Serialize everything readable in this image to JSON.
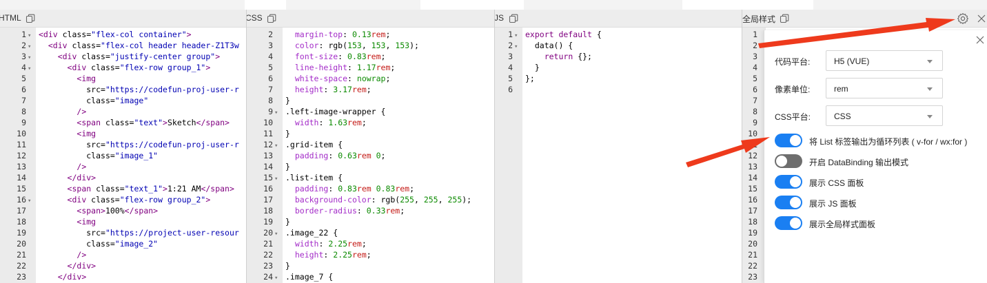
{
  "panels": {
    "html": {
      "title": "HTML"
    },
    "css": {
      "title": "CSS"
    },
    "js": {
      "title": "JS"
    },
    "global": {
      "title": "全局样式"
    }
  },
  "html_lines": [
    [
      [
        [
          "tag",
          "<div "
        ],
        [
          "attr",
          "class="
        ],
        [
          "str",
          "\"flex-col container\""
        ],
        [
          "tag",
          ">"
        ]
      ]
    ],
    [
      [
        [
          "txt",
          "  "
        ],
        [
          "tag",
          "<div "
        ],
        [
          "attr",
          "class="
        ],
        [
          "str",
          "\"flex-col header header-Z1T3w"
        ]
      ]
    ],
    [
      [
        [
          "txt",
          "    "
        ],
        [
          "tag",
          "<div "
        ],
        [
          "attr",
          "class="
        ],
        [
          "str",
          "\"justify-center group\""
        ],
        [
          "tag",
          ">"
        ]
      ]
    ],
    [
      [
        [
          "txt",
          "      "
        ],
        [
          "tag",
          "<div "
        ],
        [
          "attr",
          "class="
        ],
        [
          "str",
          "\"flex-row group_1\""
        ],
        [
          "tag",
          ">"
        ]
      ]
    ],
    [
      [
        [
          "txt",
          "        "
        ],
        [
          "tag",
          "<img"
        ]
      ]
    ],
    [
      [
        [
          "txt",
          "          "
        ],
        [
          "attr",
          "src="
        ],
        [
          "str",
          "\"https://codefun-proj-user-r"
        ]
      ]
    ],
    [
      [
        [
          "txt",
          "          "
        ],
        [
          "attr",
          "class="
        ],
        [
          "str",
          "\"image\""
        ]
      ]
    ],
    [
      [
        [
          "txt",
          "        "
        ],
        [
          "tag",
          "/>"
        ]
      ]
    ],
    [
      [
        [
          "txt",
          "        "
        ],
        [
          "tag",
          "<span "
        ],
        [
          "attr",
          "class="
        ],
        [
          "str",
          "\"text\""
        ],
        [
          "tag",
          ">"
        ],
        [
          "txt",
          "Sketch"
        ],
        [
          "tag",
          "</span>"
        ]
      ]
    ],
    [
      [
        [
          "txt",
          "        "
        ],
        [
          "tag",
          "<img"
        ]
      ]
    ],
    [
      [
        [
          "txt",
          "          "
        ],
        [
          "attr",
          "src="
        ],
        [
          "str",
          "\"https://codefun-proj-user-r"
        ]
      ]
    ],
    [
      [
        [
          "txt",
          "          "
        ],
        [
          "attr",
          "class="
        ],
        [
          "str",
          "\"image_1\""
        ]
      ]
    ],
    [
      [
        [
          "txt",
          "        "
        ],
        [
          "tag",
          "/>"
        ]
      ]
    ],
    [
      [
        [
          "txt",
          "      "
        ],
        [
          "tag",
          "</div>"
        ]
      ]
    ],
    [
      [
        [
          "txt",
          "      "
        ],
        [
          "tag",
          "<span "
        ],
        [
          "attr",
          "class="
        ],
        [
          "str",
          "\"text_1\""
        ],
        [
          "tag",
          ">"
        ],
        [
          "txt",
          "1:21 AM"
        ],
        [
          "tag",
          "</span>"
        ]
      ]
    ],
    [
      [
        [
          "txt",
          "      "
        ],
        [
          "tag",
          "<div "
        ],
        [
          "attr",
          "class="
        ],
        [
          "str",
          "\"flex-row group_2\""
        ],
        [
          "tag",
          ">"
        ]
      ]
    ],
    [
      [
        [
          "txt",
          "        "
        ],
        [
          "tag",
          "<span>"
        ],
        [
          "txt",
          "100%"
        ],
        [
          "tag",
          "</span>"
        ]
      ]
    ],
    [
      [
        [
          "txt",
          "        "
        ],
        [
          "tag",
          "<img"
        ]
      ]
    ],
    [
      [
        [
          "txt",
          "          "
        ],
        [
          "attr",
          "src="
        ],
        [
          "str",
          "\"https://project-user-resour"
        ]
      ]
    ],
    [
      [
        [
          "txt",
          "          "
        ],
        [
          "attr",
          "class="
        ],
        [
          "str",
          "\"image_2\""
        ]
      ]
    ],
    [
      [
        [
          "txt",
          "        "
        ],
        [
          "tag",
          "/>"
        ]
      ]
    ],
    [
      [
        [
          "txt",
          "      "
        ],
        [
          "tag",
          "</div>"
        ]
      ]
    ],
    [
      [
        [
          "txt",
          "    "
        ],
        [
          "tag",
          "</div>"
        ]
      ]
    ]
  ],
  "html_numbers": [
    "1",
    "2",
    "3",
    "4",
    "5",
    "6",
    "7",
    "8",
    "9",
    "10",
    "11",
    "12",
    "13",
    "14",
    "15",
    "16",
    "17",
    "18",
    "19",
    "20",
    "21",
    "22",
    "23"
  ],
  "html_folds": [
    "1",
    "2",
    "3",
    "4",
    "16"
  ],
  "css_lines": [
    [
      [
        [
          "txt",
          "  "
        ],
        [
          "prop",
          "margin-top"
        ],
        [
          "txt",
          ": "
        ],
        [
          "num",
          "0.13"
        ],
        [
          "unit",
          "rem"
        ],
        [
          "txt",
          ";"
        ]
      ]
    ],
    [
      [
        [
          "txt",
          "  "
        ],
        [
          "prop",
          "color"
        ],
        [
          "txt",
          ": rgb("
        ],
        [
          "num",
          "153"
        ],
        [
          "txt",
          ", "
        ],
        [
          "num",
          "153"
        ],
        [
          "txt",
          ", "
        ],
        [
          "num",
          "153"
        ],
        [
          "txt",
          ");"
        ]
      ]
    ],
    [
      [
        [
          "txt",
          "  "
        ],
        [
          "prop",
          "font-size"
        ],
        [
          "txt",
          ": "
        ],
        [
          "num",
          "0.83"
        ],
        [
          "unit",
          "rem"
        ],
        [
          "txt",
          ";"
        ]
      ]
    ],
    [
      [
        [
          "txt",
          "  "
        ],
        [
          "prop",
          "line-height"
        ],
        [
          "txt",
          ": "
        ],
        [
          "num",
          "1.17"
        ],
        [
          "unit",
          "rem"
        ],
        [
          "txt",
          ";"
        ]
      ]
    ],
    [
      [
        [
          "txt",
          "  "
        ],
        [
          "prop",
          "white-space"
        ],
        [
          "txt",
          ": "
        ],
        [
          "num",
          "nowrap"
        ],
        [
          "txt",
          ";"
        ]
      ]
    ],
    [
      [
        [
          "txt",
          "  "
        ],
        [
          "prop",
          "height"
        ],
        [
          "txt",
          ": "
        ],
        [
          "num",
          "3.17"
        ],
        [
          "unit",
          "rem"
        ],
        [
          "txt",
          ";"
        ]
      ]
    ],
    [
      [
        [
          "txt",
          "}"
        ]
      ]
    ],
    [
      [
        [
          "txt",
          ".left-image-wrapper {"
        ]
      ]
    ],
    [
      [
        [
          "txt",
          "  "
        ],
        [
          "prop",
          "width"
        ],
        [
          "txt",
          ": "
        ],
        [
          "num",
          "1.63"
        ],
        [
          "unit",
          "rem"
        ],
        [
          "txt",
          ";"
        ]
      ]
    ],
    [
      [
        [
          "txt",
          "}"
        ]
      ]
    ],
    [
      [
        [
          "txt",
          ".grid-item {"
        ]
      ]
    ],
    [
      [
        [
          "txt",
          "  "
        ],
        [
          "prop",
          "padding"
        ],
        [
          "txt",
          ": "
        ],
        [
          "num",
          "0.63"
        ],
        [
          "unit",
          "rem"
        ],
        [
          "txt",
          " "
        ],
        [
          "num",
          "0"
        ],
        [
          "txt",
          ";"
        ]
      ]
    ],
    [
      [
        [
          "txt",
          "}"
        ]
      ]
    ],
    [
      [
        [
          "txt",
          ".list-item {"
        ]
      ]
    ],
    [
      [
        [
          "txt",
          "  "
        ],
        [
          "prop",
          "padding"
        ],
        [
          "txt",
          ": "
        ],
        [
          "num",
          "0.83"
        ],
        [
          "unit",
          "rem"
        ],
        [
          "txt",
          " "
        ],
        [
          "num",
          "0.83"
        ],
        [
          "unit",
          "rem"
        ],
        [
          "txt",
          ";"
        ]
      ]
    ],
    [
      [
        [
          "txt",
          "  "
        ],
        [
          "prop",
          "background-color"
        ],
        [
          "txt",
          ": rgb("
        ],
        [
          "num",
          "255"
        ],
        [
          "txt",
          ", "
        ],
        [
          "num",
          "255"
        ],
        [
          "txt",
          ", "
        ],
        [
          "num",
          "255"
        ],
        [
          "txt",
          ");"
        ]
      ]
    ],
    [
      [
        [
          "txt",
          "  "
        ],
        [
          "prop",
          "border-radius"
        ],
        [
          "txt",
          ": "
        ],
        [
          "num",
          "0.33"
        ],
        [
          "unit",
          "rem"
        ],
        [
          "txt",
          ";"
        ]
      ]
    ],
    [
      [
        [
          "txt",
          "}"
        ]
      ]
    ],
    [
      [
        [
          "txt",
          ".image_22 {"
        ]
      ]
    ],
    [
      [
        [
          "txt",
          "  "
        ],
        [
          "prop",
          "width"
        ],
        [
          "txt",
          ": "
        ],
        [
          "num",
          "2.25"
        ],
        [
          "unit",
          "rem"
        ],
        [
          "txt",
          ";"
        ]
      ]
    ],
    [
      [
        [
          "txt",
          "  "
        ],
        [
          "prop",
          "height"
        ],
        [
          "txt",
          ": "
        ],
        [
          "num",
          "2.25"
        ],
        [
          "unit",
          "rem"
        ],
        [
          "txt",
          ";"
        ]
      ]
    ],
    [
      [
        [
          "txt",
          "}"
        ]
      ]
    ],
    [
      [
        [
          "txt",
          ".image_7 {"
        ]
      ]
    ]
  ],
  "css_numbers": [
    "2",
    "3",
    "4",
    "5",
    "6",
    "7",
    "8",
    "9",
    "10",
    "11",
    "12",
    "13",
    "14",
    "15",
    "16",
    "17",
    "18",
    "19",
    "20",
    "21",
    "22",
    "23",
    "24"
  ],
  "css_folds": [
    "9",
    "12",
    "15",
    "20",
    "24"
  ],
  "js_lines": [
    [
      [
        [
          "kw",
          "export default"
        ],
        [
          "txt",
          " {"
        ]
      ]
    ],
    [
      [
        [
          "txt",
          "  data() {"
        ]
      ]
    ],
    [
      [
        [
          "txt",
          "    "
        ],
        [
          "kw",
          "return"
        ],
        [
          "txt",
          " {};"
        ]
      ]
    ],
    [
      [
        [
          "txt",
          "  }"
        ]
      ]
    ],
    [
      [
        [
          "txt",
          "};"
        ]
      ]
    ],
    [
      [
        [
          "txt",
          ""
        ]
      ]
    ]
  ],
  "js_numbers": [
    "1",
    "2",
    "3",
    "4",
    "5",
    "6"
  ],
  "js_folds": [
    "1",
    "2"
  ],
  "global_numbers": [
    "1",
    "2",
    "3",
    "4",
    "5",
    "6",
    "7",
    "8",
    "9",
    "10",
    "11",
    "12",
    "13",
    "14",
    "15",
    "16",
    "17",
    "18",
    "19",
    "20",
    "21",
    "22",
    "23"
  ],
  "settings": {
    "platform_label": "代码平台:",
    "platform_value": "H5 (VUE)",
    "unit_label": "像素单位:",
    "unit_value": "rem",
    "css_label": "CSS平台:",
    "css_value": "CSS",
    "toggles": [
      {
        "label": "将 List 标签输出为循环列表 ( v-for / wx:for )",
        "on": true
      },
      {
        "label": "开启 DataBinding 输出模式",
        "on": false
      },
      {
        "label": "展示 CSS 面板",
        "on": true
      },
      {
        "label": "展示 JS 面板",
        "on": true
      },
      {
        "label": "展示全局样式面板",
        "on": true
      }
    ]
  },
  "colors": {
    "accent": "#1a7ff2",
    "annotation_arrow": "#ee3a1c",
    "toggle_off": "#6e6e6e"
  },
  "icons": [
    "copy-icon",
    "gear-icon",
    "close-icon",
    "caret-down-icon"
  ]
}
